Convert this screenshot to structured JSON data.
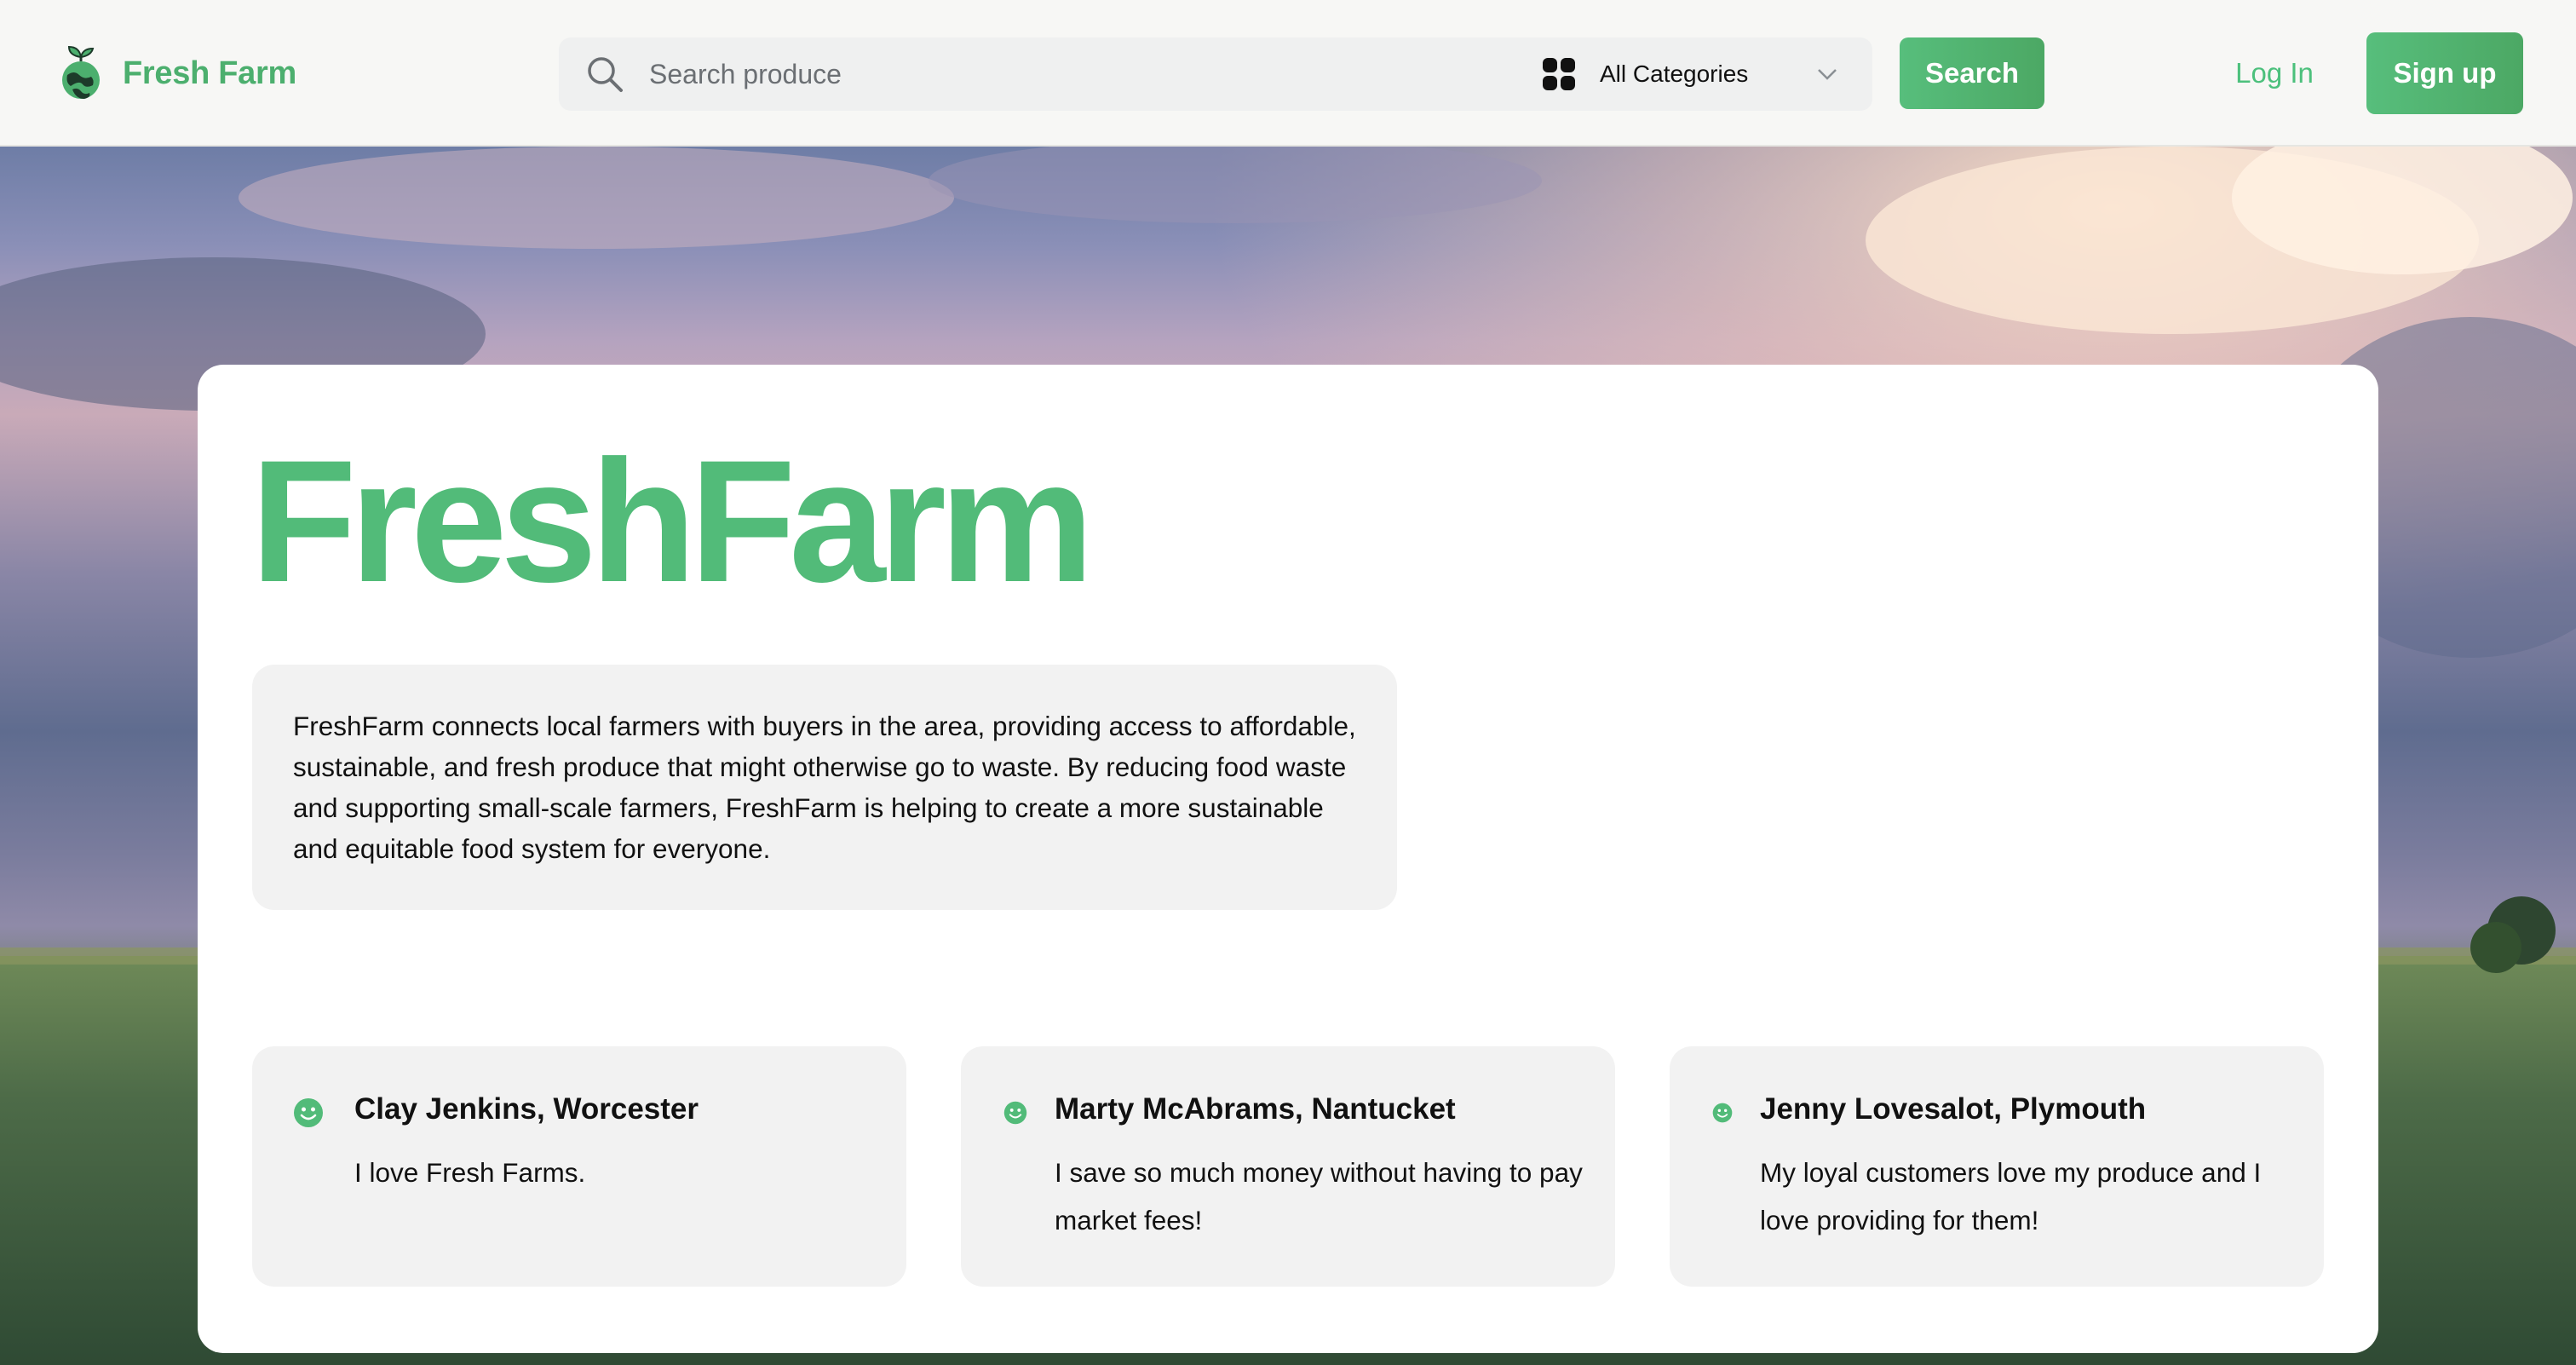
{
  "nav": {
    "brand_name": "Fresh Farm",
    "search_placeholder": "Search produce",
    "category_selected": "All Categories",
    "search_button": "Search",
    "login_link": "Log In",
    "signup_button": "Sign up"
  },
  "colors": {
    "brand_green": "#52bb79",
    "panel_gray": "#f2f2f2",
    "nav_bg": "#f7f7f5"
  },
  "icons": {
    "brand": "sprout-globe-icon",
    "search": "search-icon",
    "categories": "grid-icon",
    "dropdown": "chevron-down-icon",
    "testimonial": "smile-icon"
  },
  "hero": {
    "title": "FreshFarm",
    "about": "FreshFarm connects local farmers with buyers in the area, providing access to affordable, sustainable, and fresh produce that might otherwise go to waste. By reducing food waste and supporting small-scale farmers, FreshFarm is helping to create a more sustainable and equitable food system for everyone."
  },
  "testimonials": [
    {
      "name": "Clay Jenkins, Worcester",
      "quote": "I love Fresh Farms."
    },
    {
      "name": "Marty McAbrams, Nantucket",
      "quote": "I save so much money without having to pay market fees!"
    },
    {
      "name": "Jenny Lovesalot, Plymouth",
      "quote": "My loyal customers love my produce and I love providing for them!"
    }
  ]
}
